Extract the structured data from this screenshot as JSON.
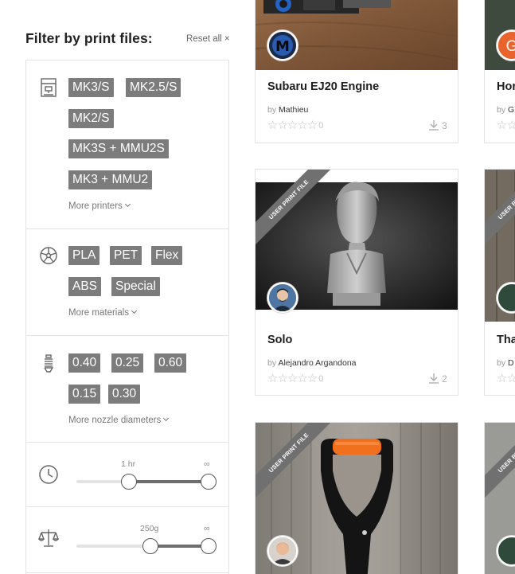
{
  "filter": {
    "title": "Filter by print files:",
    "reset_label": "Reset all",
    "reset_icon": "×",
    "printers": [
      "MK3/S",
      "MK2.5/S",
      "MK2/S",
      "MK3S + MMU2S",
      "MK3 + MMU2"
    ],
    "more_printers": "More printers",
    "materials": [
      "PLA",
      "PET",
      "Flex",
      "ABS",
      "Special"
    ],
    "more_materials": "More materials",
    "nozzles": [
      "0.40",
      "0.25",
      "0.60",
      "0.15",
      "0.30"
    ],
    "more_nozzles": "More nozzle diameters",
    "time_slider": {
      "min_label": "1 hr",
      "max_label": "∞",
      "min_fraction": 0.4,
      "max_fraction": 1.0
    },
    "weight_slider": {
      "min_label": "250g",
      "max_label": "∞",
      "min_fraction": 0.56,
      "max_fraction": 1.0
    }
  },
  "cards": [
    {
      "title": "Subaru EJ20 Engine",
      "by_label": "by",
      "author": "Mathieu",
      "stars_text": "☆☆☆☆☆",
      "rating_count": "0",
      "downloads": "3",
      "avatar_letter": "M"
    },
    {
      "title": "Solo",
      "by_label": "by",
      "author": "Alejandro Argandona",
      "stars_text": "☆☆☆☆☆",
      "rating_count": "0",
      "downloads": "2",
      "ribbon": "USER PRINT FILE"
    },
    {
      "ribbon": "USER PRINT FILE"
    }
  ],
  "cards_right": [
    {
      "title": "Hor",
      "by_label": "by",
      "author": "G",
      "avatar_letter": "G",
      "stars_text": "☆☆"
    },
    {
      "title": "Tha",
      "by_label": "by",
      "author": "D",
      "stars_text": "☆☆",
      "ribbon": "USER PRINT FILE"
    },
    {
      "ribbon": "USER PRINT FILE"
    }
  ],
  "icons": {
    "printer": "printer-icon",
    "material": "filament-spool-icon",
    "nozzle": "nozzle-icon",
    "time": "clock-icon",
    "weight": "scale-icon",
    "download": "download-icon",
    "star": "star-icon"
  },
  "colors": {
    "tag_bg": "#7c7c7c",
    "ribbon_bg": "#707070",
    "avatar_orange": "#e8642c",
    "handle_orange": "#f0701e"
  }
}
